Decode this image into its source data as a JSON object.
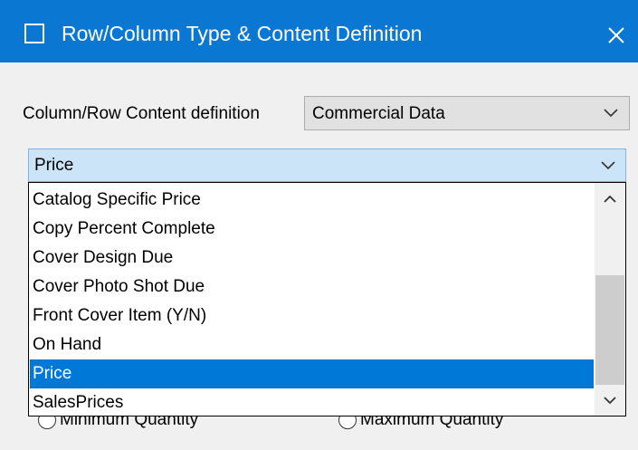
{
  "window": {
    "title": "Row/Column Type & Content Definition",
    "app_icon": "square-outline-icon",
    "close_icon": "close-icon",
    "accent_color": "#0a78d2"
  },
  "content_definition": {
    "label": "Column/Row Content definition",
    "selected_value": "Commercial Data"
  },
  "field_combo": {
    "selected_value": "Price"
  },
  "dropdown": {
    "items": [
      "Catalog Specific Price",
      "Copy Percent Complete",
      "Cover Design Due",
      "Cover Photo Shot Due",
      "Front Cover Item (Y/N)",
      "On Hand",
      "Price",
      "SalesPrices"
    ],
    "selected_index": 6,
    "selection_color": "#0078d7"
  },
  "radios": {
    "minimum_label": "Minimum Quantity",
    "maximum_label": "Maximum Quantity"
  }
}
